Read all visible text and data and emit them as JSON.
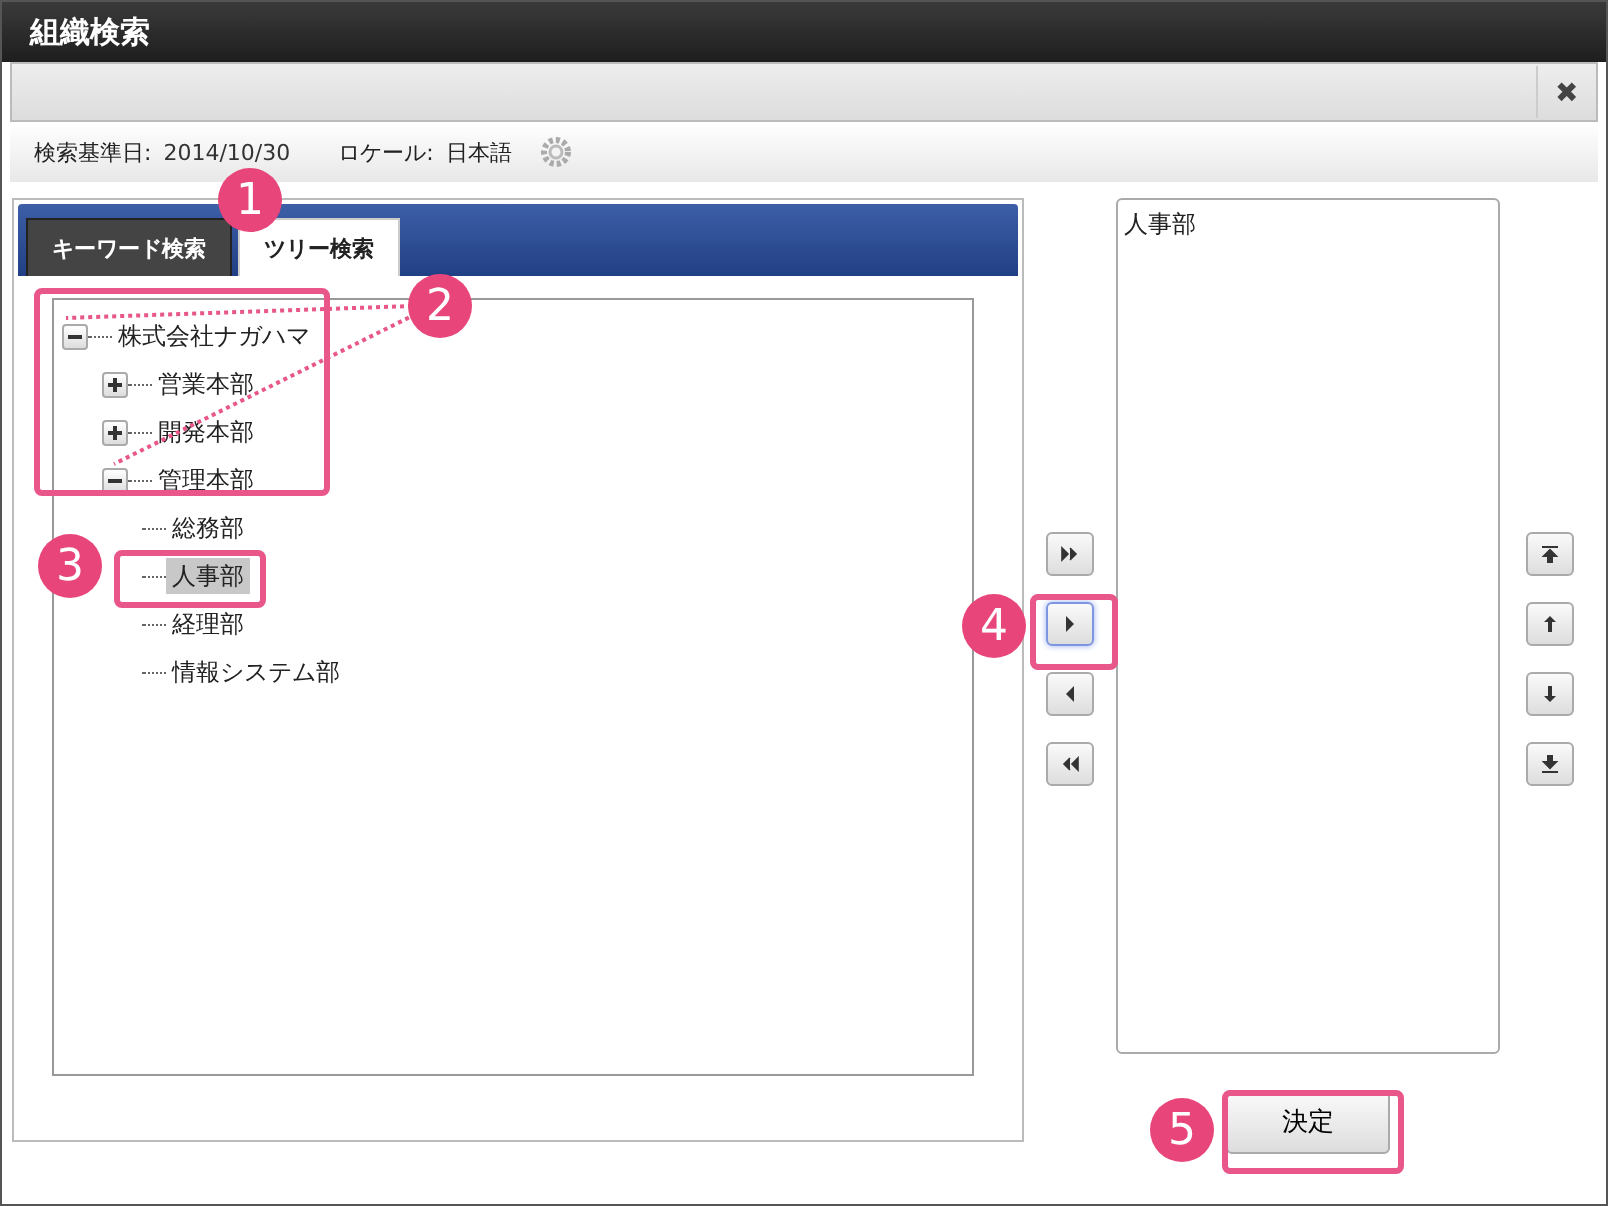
{
  "window": {
    "title": "組織検索",
    "close": "✖"
  },
  "info": {
    "date_label": "検索基準日:",
    "date": "2014/10/30",
    "locale_label": "ロケール:",
    "locale": "日本語"
  },
  "tabs": [
    {
      "label": "キーワード検索",
      "selected": false
    },
    {
      "label": "ツリー検索",
      "selected": true
    }
  ],
  "tree": [
    {
      "label": "株式会社ナガハマ",
      "expanded": true,
      "selected": false,
      "children": [
        {
          "label": "営業本部",
          "expanded": false,
          "selected": false
        },
        {
          "label": "開発本部",
          "expanded": false,
          "selected": false
        },
        {
          "label": "管理本部",
          "expanded": true,
          "selected": false,
          "children": [
            {
              "label": "総務部",
              "selected": false
            },
            {
              "label": "人事部",
              "selected": true
            },
            {
              "label": "経理部",
              "selected": false
            },
            {
              "label": "情報システム部",
              "selected": false
            }
          ]
        }
      ]
    }
  ],
  "move_buttons": [
    {
      "kind": "add-all",
      "focused": false
    },
    {
      "kind": "add",
      "focused": true
    },
    {
      "kind": "remove",
      "focused": false
    },
    {
      "kind": "remove-all",
      "focused": false
    }
  ],
  "selected_list": [
    {
      "label": "人事部"
    }
  ],
  "order_buttons": [
    {
      "kind": "top"
    },
    {
      "kind": "up"
    },
    {
      "kind": "down"
    },
    {
      "kind": "bottom"
    }
  ],
  "confirm_button": "決定",
  "callouts": [
    {
      "label": "1"
    },
    {
      "label": "2"
    },
    {
      "label": "3"
    },
    {
      "label": "4"
    },
    {
      "label": "5"
    }
  ]
}
